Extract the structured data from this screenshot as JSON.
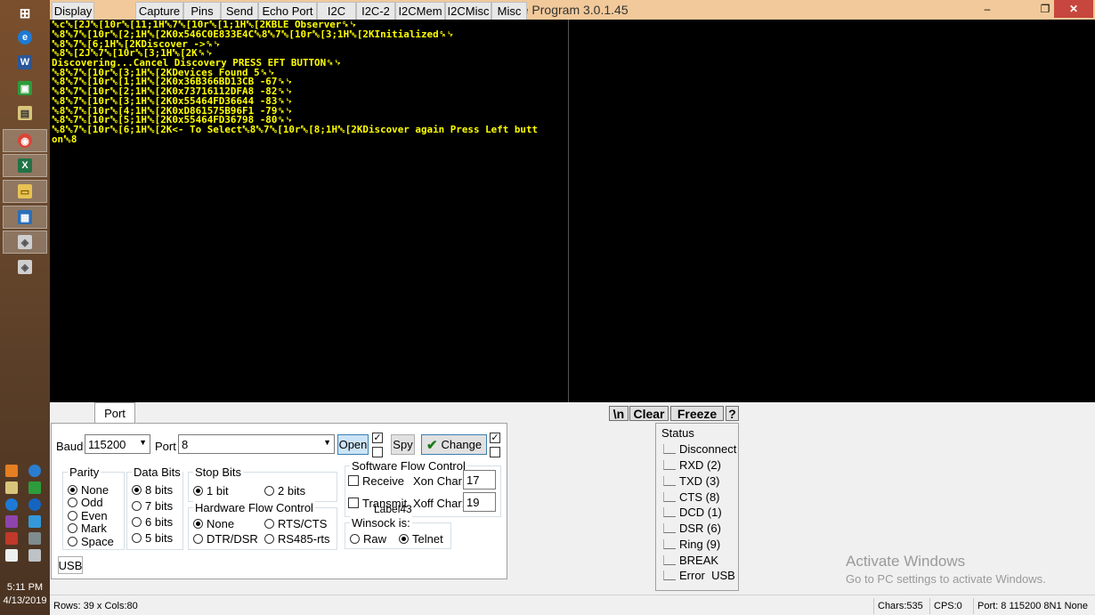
{
  "window": {
    "title": "RealTerm: Serial Capture Program 3.0.1.45",
    "minimize": "–",
    "restore": "❐",
    "close": "✕"
  },
  "taskbar": {
    "clock_time": "5:11 PM",
    "clock_date": "4/13/2019",
    "apps": [
      {
        "icon": "windows-start-icon",
        "glyph": "⊞"
      },
      {
        "icon": "internet-explorer-icon",
        "glyph": "e"
      },
      {
        "icon": "word-icon",
        "glyph": "W"
      },
      {
        "icon": "store-icon",
        "glyph": "▣"
      },
      {
        "icon": "app-icon",
        "glyph": "▤"
      },
      {
        "icon": "chrome-icon",
        "glyph": "◉"
      },
      {
        "icon": "excel-icon",
        "glyph": "X"
      },
      {
        "icon": "file-explorer-icon",
        "glyph": "▭"
      },
      {
        "icon": "realterm-icon",
        "glyph": "▦"
      },
      {
        "icon": "cube-icon",
        "glyph": "◈"
      },
      {
        "icon": "cube-icon-2",
        "glyph": "◈"
      }
    ]
  },
  "terminal": {
    "lines": [
      "␛c␛[2J␛[10r␛[11;1H␛7␛[10r␛[1;1H␛[2KBLE Observer␍␊",
      "␛8␛7␛[10r␛[2;1H␛[2K0x546C0E833E4C␛8␛7␛[10r␛[3;1H␛[2KInitialized␍␊",
      "␛8␛7␛[6;1H␛[2KDiscover ->␍␊",
      "␛8␛[2J␛7␛[10r␛[3;1H␛[2K␍␊",
      "Discovering...Cancel Discovery PRESS EFT BUTTON␍␊",
      "␛8␛7␛[10r␛[3;1H␛[2KDevices Found 5␍␊",
      "␛8␛7␛[10r␛[1;1H␛[2K0x36B366BD13CB -67␍␊",
      "␛8␛7␛[10r␛[2;1H␛[2K0x73716112DFA8 -82␍␊",
      "␛8␛7␛[10r␛[3;1H␛[2K0x55464FD36644 -83␍␊",
      "␛8␛7␛[10r␛[4;1H␛[2K0xD861575B96F1 -79␍␊",
      "␛8␛7␛[10r␛[5;1H␛[2K0x55464FD36798 -80␍␊",
      "␛8␛7␛[10r␛[6;1H␛[2K<- To Select␛8␛7␛[10r␛[8;1H␛[2KDiscover again Press Left butt",
      "on␛8"
    ]
  },
  "tabs": [
    "Display",
    "Port",
    "Capture",
    "Pins",
    "Send",
    "Echo Port",
    "I2C",
    "I2C-2",
    "I2CMem",
    "I2CMisc",
    "Misc"
  ],
  "active_tab": "Port",
  "quick_buttons": {
    "newline": "\\n",
    "clear": "Clear",
    "freeze": "Freeze",
    "help": "?"
  },
  "port": {
    "baud_label": "Baud",
    "baud_value": "115200",
    "port_label": "Port",
    "port_value": "8",
    "open_label": "Open",
    "spy_label": "Spy",
    "change_label": "Change",
    "usb_label": "USB",
    "label43": "Label43"
  },
  "parity": {
    "title": "Parity",
    "options": [
      "None",
      "Odd",
      "Even",
      "Mark",
      "Space"
    ],
    "selected": "None"
  },
  "data_bits": {
    "title": "Data Bits",
    "options": [
      "8 bits",
      "7 bits",
      "6 bits",
      "5 bits"
    ],
    "selected": "8 bits"
  },
  "stop_bits": {
    "title": "Stop Bits",
    "options": [
      "1 bit",
      "2 bits"
    ],
    "selected": "1 bit"
  },
  "hw_flow": {
    "title": "Hardware Flow Control",
    "options": [
      "None",
      "RTS/CTS",
      "DTR/DSR",
      "RS485-rts"
    ],
    "selected": "None"
  },
  "sw_flow": {
    "title": "Software Flow Control",
    "receive": "Receive",
    "transmit": "Transmit",
    "xon_label": "Xon Char:",
    "xon_value": "17",
    "xoff_label": "Xoff Char:",
    "xoff_value": "19"
  },
  "winsock": {
    "title": "Winsock is:",
    "options": [
      "Raw",
      "Telnet"
    ],
    "selected": "Telnet"
  },
  "status": {
    "title": "Status",
    "items": [
      "Disconnect",
      "RXD (2)",
      "TXD (3)",
      "CTS (8)",
      "DCD (1)",
      "DSR (6)",
      "Ring (9)",
      "BREAK",
      "Error  USB"
    ]
  },
  "watermark": {
    "line1": "Activate Windows",
    "line2": "Go to PC settings to activate Windows."
  },
  "statusbar": {
    "rows_cols": "Rows: 39 x Cols:80",
    "chars": "Chars:535",
    "cps": "CPS:0",
    "port_info": "Port: 8  115200 8N1 None"
  }
}
